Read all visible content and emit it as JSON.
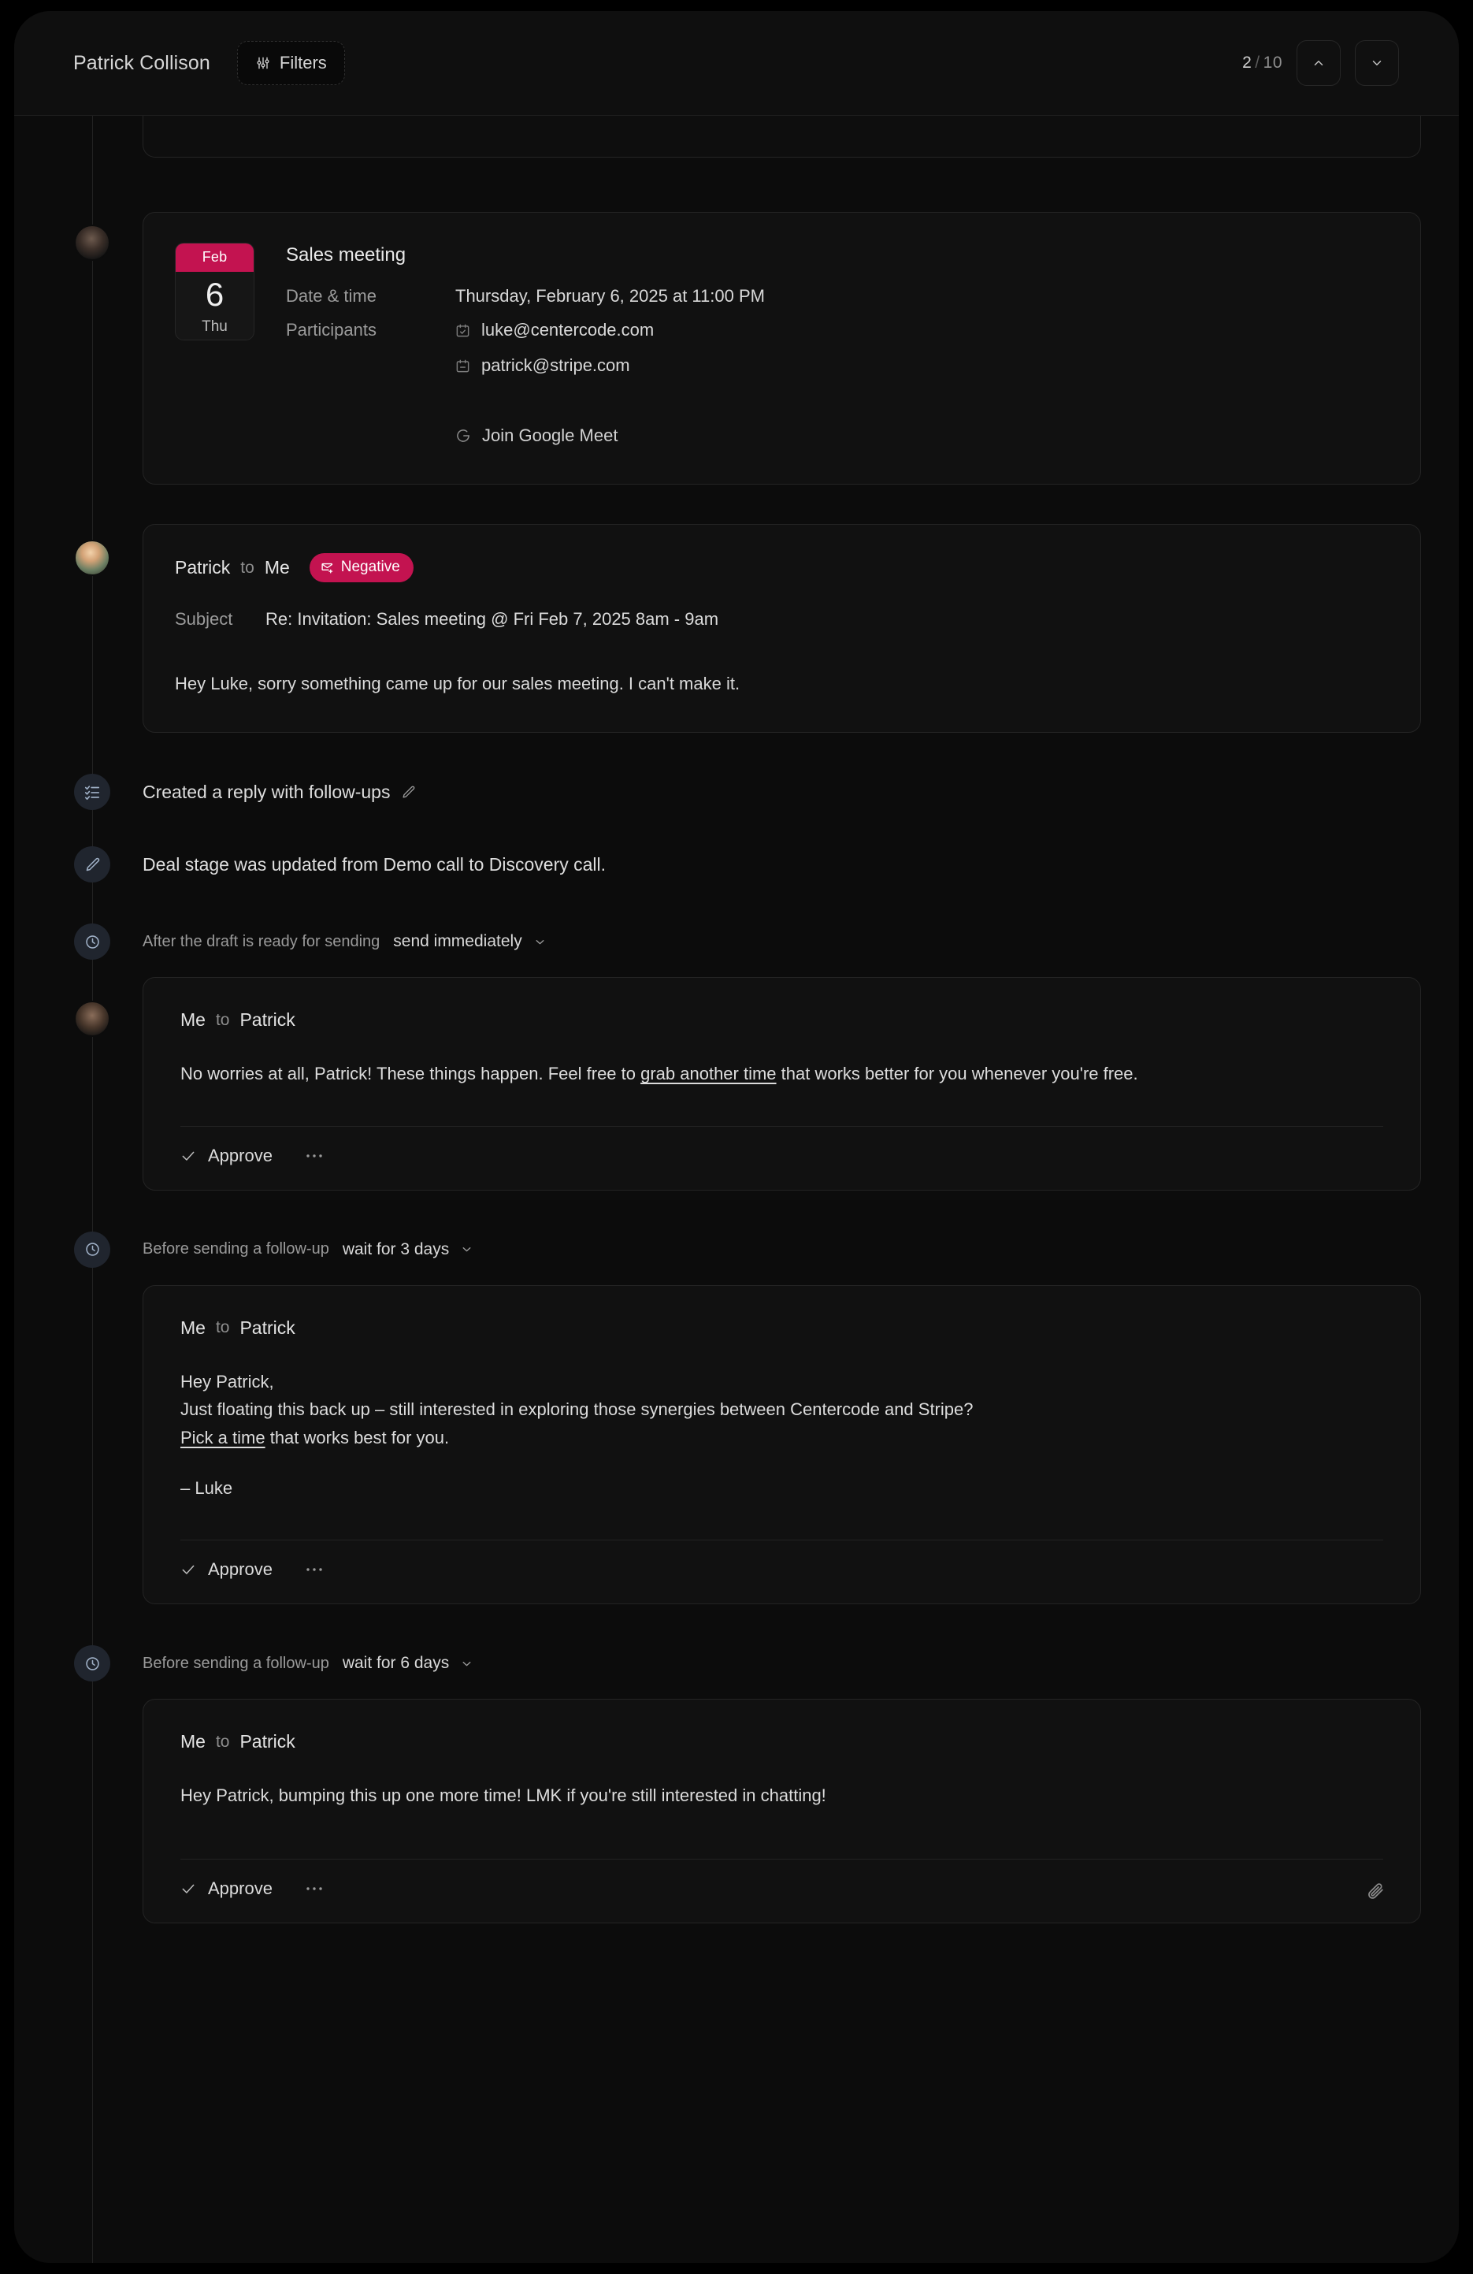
{
  "header": {
    "contact_name": "Patrick Collison",
    "filters_label": "Filters",
    "filters_icon": "sliders-icon",
    "pager": {
      "current": "2",
      "separator": "/",
      "total": "10"
    },
    "nav_up_icon": "chevron-up-icon",
    "nav_down_icon": "chevron-down-icon"
  },
  "meeting": {
    "calendar": {
      "month": "Feb",
      "day": "6",
      "weekday": "Thu"
    },
    "title": "Sales meeting",
    "datetime_label": "Date & time",
    "datetime_value": "Thursday, February 6, 2025 at 11:00 PM",
    "participants_label": "Participants",
    "participants": [
      {
        "email": "luke@centercode.com",
        "icon": "calendar-check-icon"
      },
      {
        "email": "patrick@stripe.com",
        "icon": "calendar-minus-icon"
      }
    ],
    "join_label": "Join Google Meet",
    "join_icon": "google-meet-icon"
  },
  "incoming_email": {
    "from": "Patrick",
    "to_word": "to",
    "to": "Me",
    "badge": {
      "label": "Negative",
      "icon": "mail-flag-icon",
      "color": "#c31350"
    },
    "subject_label": "Subject",
    "subject_value": "Re: Invitation: Sales meeting @ Fri Feb 7, 2025 8am - 9am",
    "body": "Hey Luke, sorry something came up for our sales meeting. I can't make it."
  },
  "activities": [
    {
      "icon": "checklist-icon",
      "text": "Created a reply with follow-ups",
      "trailing_icon": "pencil-edit-icon"
    },
    {
      "icon": "pencil-icon",
      "text": "Deal stage was updated from Demo call to Discovery call.",
      "trailing_icon": ""
    }
  ],
  "drafts": [
    {
      "schedule_icon": "clock-icon",
      "schedule_label": "After the draft is ready for sending",
      "schedule_value": "send immediately",
      "schedule_caret": "chevron-down-icon",
      "from": "Me",
      "to_word": "to",
      "to": "Patrick",
      "body_pre": "No worries at all, Patrick! These things happen. Feel free to ",
      "body_link": "grab another time",
      "body_post": " that works better for you whenever you're free.",
      "approve_label": "Approve",
      "approve_icon": "check-icon",
      "more_icon": "ellipsis-icon",
      "attach_icon": ""
    },
    {
      "schedule_icon": "clock-icon",
      "schedule_label": "Before sending a follow-up",
      "schedule_value": "wait for 3 days",
      "schedule_caret": "chevron-down-icon",
      "from": "Me",
      "to_word": "to",
      "to": "Patrick",
      "greeting": "Hey Patrick,",
      "line1": "Just floating this back up – still interested in exploring those synergies between Centercode and Stripe?",
      "body_link": "Pick a time",
      "body_post": " that works best for you.",
      "signature": "– Luke",
      "approve_label": "Approve",
      "approve_icon": "check-icon",
      "more_icon": "ellipsis-icon",
      "attach_icon": ""
    },
    {
      "schedule_icon": "clock-icon",
      "schedule_label": "Before sending a follow-up",
      "schedule_value": "wait for 6 days",
      "schedule_caret": "chevron-down-icon",
      "from": "Me",
      "to_word": "to",
      "to": "Patrick",
      "body_pre": "Hey Patrick, bumping this up one more time! LMK if you're still interested in chatting!",
      "approve_label": "Approve",
      "approve_icon": "check-icon",
      "more_icon": "ellipsis-icon",
      "attach_icon": "paperclip-icon"
    }
  ],
  "theme": {
    "accent": "#c31350",
    "background": "#0c0c0c",
    "card_background": "#111111",
    "card_border": "#242424",
    "text_primary": "#dedede",
    "text_muted": "#9a9a9a"
  }
}
